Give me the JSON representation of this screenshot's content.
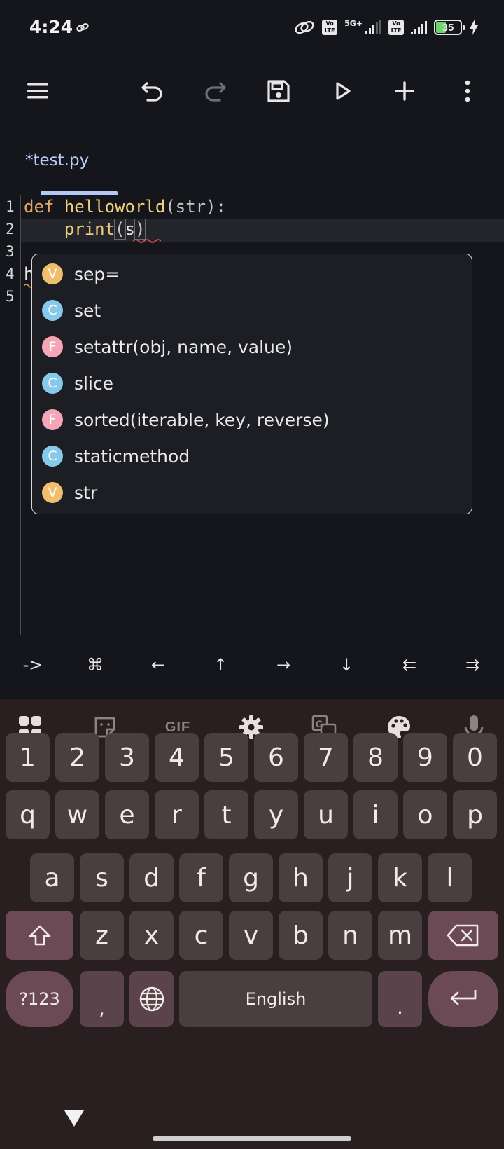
{
  "status_bar": {
    "time": "4:24",
    "network": "5G+",
    "volte_1": "Vo LTE",
    "volte_2": "Vo LTE",
    "battery": "35"
  },
  "toolbar": {
    "buttons": [
      "menu-icon",
      "undo-icon",
      "redo-icon",
      "save-icon",
      "run-icon",
      "add-icon",
      "more-icon"
    ]
  },
  "tab": {
    "label": "*test.py"
  },
  "editor": {
    "line_numbers": [
      "1",
      "2",
      "3",
      "4",
      "5"
    ],
    "line1": {
      "kw": "def",
      "fn": "helloworld",
      "rest": "(str):"
    },
    "line2": {
      "indent": "    ",
      "fn": "print",
      "open": "(",
      "arg": "s",
      "close": ")"
    },
    "line4": {
      "text": "h"
    }
  },
  "completion": {
    "items": [
      {
        "kind": "V",
        "label": "sep="
      },
      {
        "kind": "C",
        "label": "set"
      },
      {
        "kind": "F",
        "label": "setattr(obj, name, value)"
      },
      {
        "kind": "C",
        "label": "slice"
      },
      {
        "kind": "F",
        "label": "sorted(iterable, key, reverse)"
      },
      {
        "kind": "C",
        "label": "staticmethod"
      },
      {
        "kind": "V",
        "label": "str"
      }
    ]
  },
  "extra_keys": [
    "->",
    "⌘",
    "←",
    "↑",
    "→",
    "↓",
    "⇇",
    "⇉"
  ],
  "keyboard": {
    "tools": [
      "apps-icon",
      "sticker-icon",
      "gif",
      "settings-icon",
      "translate-icon",
      "palette-icon",
      "mic-icon"
    ],
    "gif_label": "GIF",
    "row_numbers": [
      "1",
      "2",
      "3",
      "4",
      "5",
      "6",
      "7",
      "8",
      "9",
      "0"
    ],
    "row1": [
      "q",
      "w",
      "e",
      "r",
      "t",
      "y",
      "u",
      "i",
      "o",
      "p"
    ],
    "row2": [
      "a",
      "s",
      "d",
      "f",
      "g",
      "h",
      "j",
      "k",
      "l"
    ],
    "row3": [
      "z",
      "x",
      "c",
      "v",
      "b",
      "n",
      "m"
    ],
    "symbols_label": "?123",
    "comma": ",",
    "space_label": "English",
    "period": "."
  },
  "colors": {
    "background": "#15161b",
    "keyboard_bg": "#291f21",
    "key": "#4a3e40",
    "key_mod": "#6b4a55",
    "tab_accent": "#b4c8f4",
    "badge_v": "#f0bf6e",
    "badge_c": "#86c9e8",
    "badge_f": "#f4a6b6"
  }
}
